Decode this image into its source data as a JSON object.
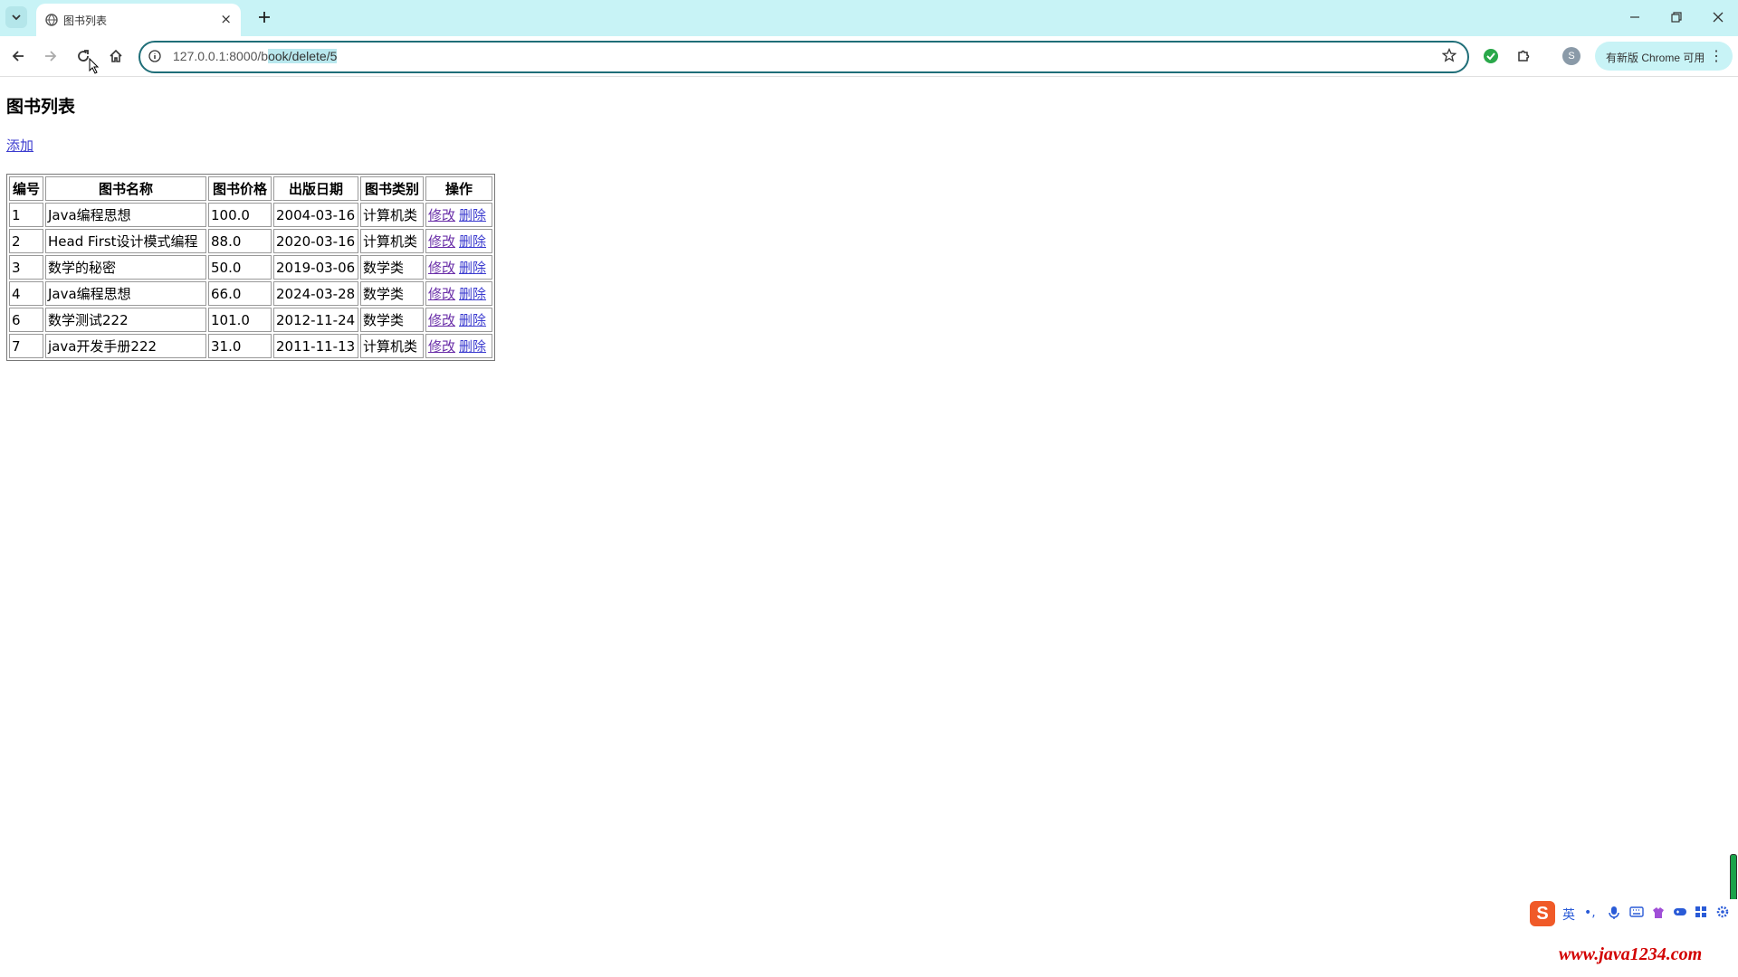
{
  "browser": {
    "tab_title": "图书列表",
    "tab_close": "×",
    "new_tab": "+",
    "url_prefix": "127.0.0.1:8000/b",
    "url_selected": "ook/delete/5",
    "update_label": "有新版 Chrome 可用",
    "profile_initial": "S",
    "menu_dots": "⋮"
  },
  "page": {
    "title": "图书列表",
    "add_link": "添加",
    "table": {
      "headers": [
        "编号",
        "图书名称",
        "图书价格",
        "出版日期",
        "图书类别",
        "操作"
      ],
      "rows": [
        {
          "id": "1",
          "name": "Java编程思想",
          "price": "100.0",
          "date": "2004-03-16",
          "category": "计算机类",
          "edit": "修改",
          "delete": "删除"
        },
        {
          "id": "2",
          "name": "Head First设计模式编程",
          "price": "88.0",
          "date": "2020-03-16",
          "category": "计算机类",
          "edit": "修改",
          "delete": "删除"
        },
        {
          "id": "3",
          "name": "数学的秘密",
          "price": "50.0",
          "date": "2019-03-06",
          "category": "数学类",
          "edit": "修改",
          "delete": "删除"
        },
        {
          "id": "4",
          "name": "Java编程思想",
          "price": "66.0",
          "date": "2024-03-28",
          "category": "数学类",
          "edit": "修改",
          "delete": "删除"
        },
        {
          "id": "6",
          "name": "数学测试222",
          "price": "101.0",
          "date": "2012-11-24",
          "category": "数学类",
          "edit": "修改",
          "delete": "删除"
        },
        {
          "id": "7",
          "name": "java开发手册222",
          "price": "31.0",
          "date": "2011-11-13",
          "category": "计算机类",
          "edit": "修改",
          "delete": "删除"
        }
      ]
    }
  },
  "ime": {
    "logo": "S",
    "lang": "英",
    "punct": "•,"
  },
  "watermark": "www.java1234.com",
  "colors": {
    "tabstrip": "#c8f3f6",
    "link": "#3b3bcf",
    "visited_link": "#6a2fa8",
    "omnibox_border": "#1f6e78",
    "watermark": "#d20000"
  }
}
